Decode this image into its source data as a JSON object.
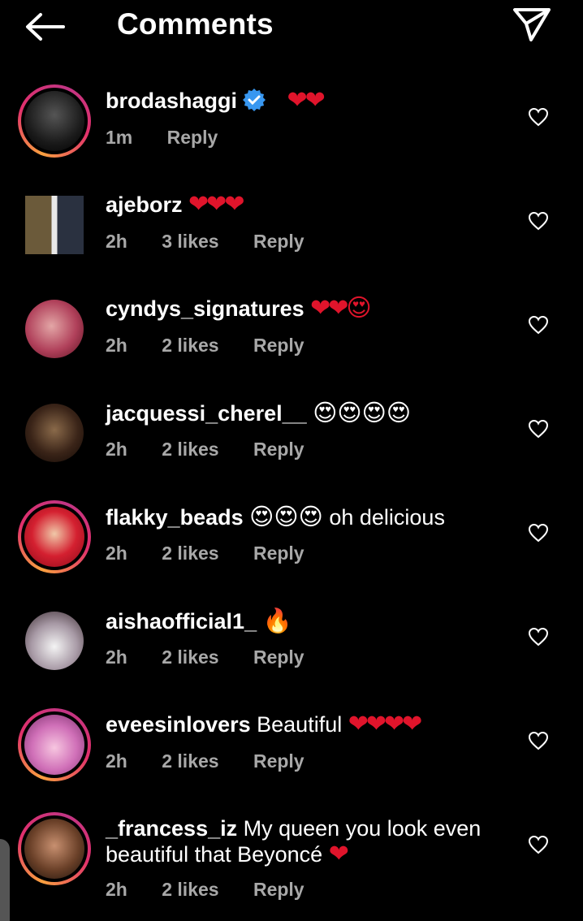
{
  "header": {
    "title": "Comments",
    "back_icon": "arrow-left-icon",
    "send_icon": "paper-plane-icon"
  },
  "colors": {
    "background": "#000000",
    "heart": "#e0142b",
    "verified": "#3897f0",
    "meta_text": "#a8a8a8"
  },
  "comments": [
    {
      "username": "brodashaggi",
      "verified": true,
      "text": "",
      "emoji": "❤❤",
      "time": "1m",
      "likes": "",
      "reply": "Reply",
      "story_ring": true
    },
    {
      "username": "ajeborz",
      "verified": false,
      "text": "",
      "emoji": "❤❤❤",
      "time": "2h",
      "likes": "3 likes",
      "reply": "Reply",
      "story_ring": false
    },
    {
      "username": "cyndys_signatures",
      "verified": false,
      "text": "",
      "emoji": "❤❤😍",
      "time": "2h",
      "likes": "2 likes",
      "reply": "Reply",
      "story_ring": false
    },
    {
      "username": "jacquessi_cherel__",
      "verified": false,
      "text": "",
      "emoji": "😍😍😍😍",
      "time": "2h",
      "likes": "2 likes",
      "reply": "Reply",
      "story_ring": false
    },
    {
      "username": "flakky_beads",
      "verified": false,
      "text": "oh delicious",
      "emoji": "😍😍😍",
      "time": "2h",
      "likes": "2 likes",
      "reply": "Reply",
      "story_ring": true
    },
    {
      "username": "aishaofficial1_",
      "verified": false,
      "text": "",
      "emoji": "🔥",
      "time": "2h",
      "likes": "2 likes",
      "reply": "Reply",
      "story_ring": false
    },
    {
      "username": "eveesinlovers",
      "verified": false,
      "text": "Beautiful",
      "emoji": "❤❤❤❤",
      "time": "2h",
      "likes": "2 likes",
      "reply": "Reply",
      "story_ring": true
    },
    {
      "username": "_francess_iz",
      "verified": false,
      "text": "My queen you look even beautiful that Beyoncé",
      "emoji": "❤",
      "time": "2h",
      "likes": "2 likes",
      "reply": "Reply",
      "story_ring": true
    }
  ]
}
